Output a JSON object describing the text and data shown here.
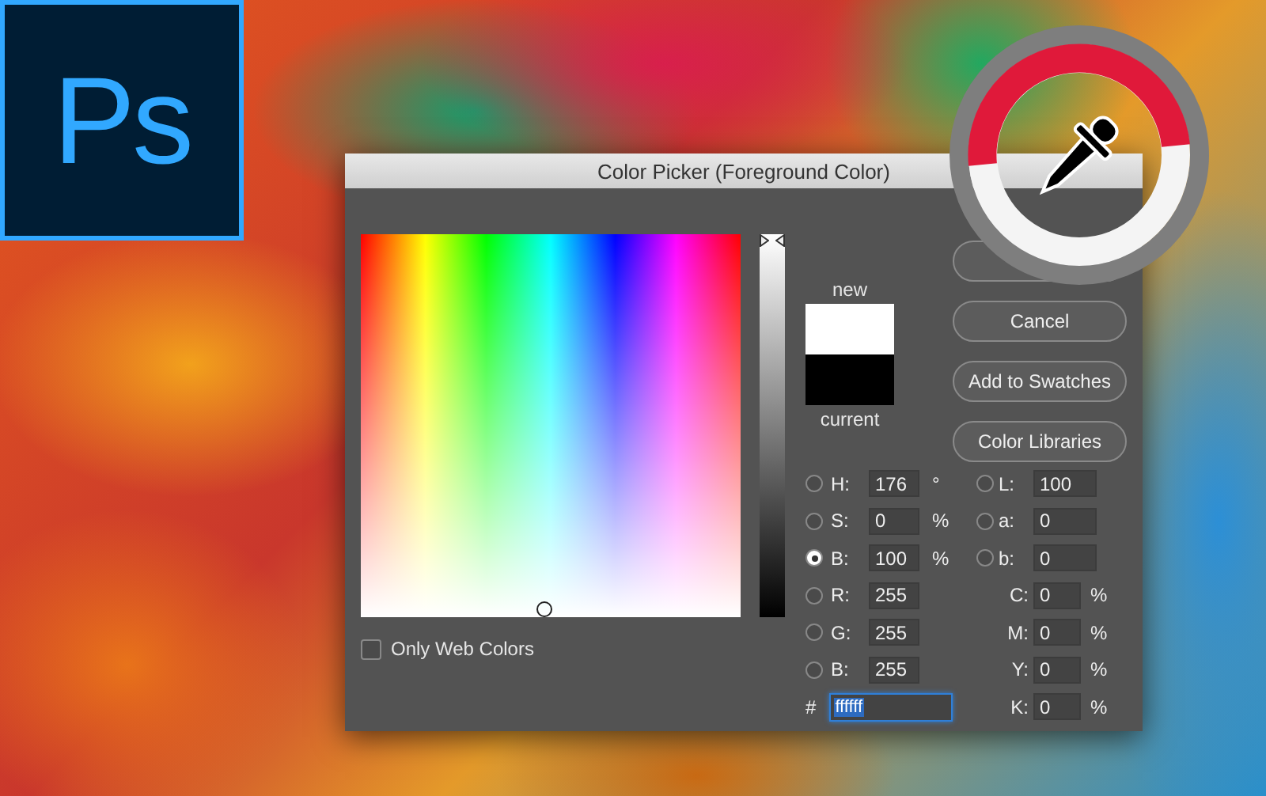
{
  "logo": {
    "text": "Ps"
  },
  "dialog": {
    "title": "Color Picker (Foreground Color)",
    "brightness_slider": {
      "level": 1
    },
    "swatch": {
      "new_label": "new",
      "current_label": "current"
    },
    "buttons": [
      {
        "kind": "covered"
      },
      {
        "kind": "button",
        "label": "Cancel"
      },
      {
        "kind": "button",
        "label": "Add to Swatches"
      },
      {
        "kind": "button",
        "label": "Color Libraries"
      }
    ],
    "only_web_colors": {
      "label": "Only Web Colors",
      "checked": false
    },
    "hsb": [
      {
        "label": "H:",
        "value": "176",
        "unit": "°",
        "selected": false
      },
      {
        "label": "S:",
        "value": "0",
        "unit": "%",
        "selected": false
      },
      {
        "label": "B:",
        "value": "100",
        "unit": "%",
        "selected": true
      }
    ],
    "lab": [
      {
        "label": "L:",
        "value": "100",
        "selected": false
      },
      {
        "label": "a:",
        "value": "0",
        "selected": false
      },
      {
        "label": "b:",
        "value": "0",
        "selected": false
      }
    ],
    "rgb": [
      {
        "label": "R:",
        "value": "255",
        "selected": false
      },
      {
        "label": "G:",
        "value": "255",
        "selected": false
      },
      {
        "label": "B:",
        "value": "255",
        "selected": false
      }
    ],
    "cmyk": [
      {
        "label": "C:",
        "value": "0",
        "unit": "%"
      },
      {
        "label": "M:",
        "value": "0",
        "unit": "%"
      },
      {
        "label": "Y:",
        "value": "0",
        "unit": "%"
      },
      {
        "label": "K:",
        "value": "0",
        "unit": "%"
      }
    ],
    "hex": {
      "symbol": "#",
      "value": "ffffff"
    }
  }
}
